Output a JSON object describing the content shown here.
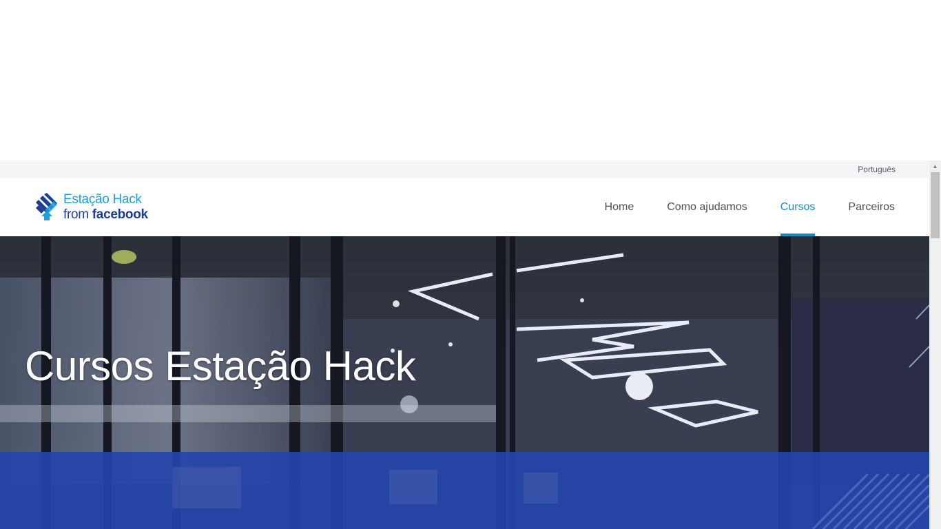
{
  "language": {
    "label": "Português"
  },
  "logo": {
    "line1": "Estação Hack",
    "line2_prefix": "from ",
    "line2_brand": "facebook"
  },
  "nav": {
    "items": [
      {
        "label": "Home",
        "active": false
      },
      {
        "label": "Como ajudamos",
        "active": false
      },
      {
        "label": "Cursos",
        "active": true
      },
      {
        "label": "Parceiros",
        "active": false
      }
    ]
  },
  "hero": {
    "title": "Cursos Estação Hack"
  },
  "colors": {
    "accent": "#1a8bc4",
    "brand_blue": "#1c3f94",
    "band_blue": "#2444aa",
    "lang_bar_bg": "#f4f5f7"
  }
}
